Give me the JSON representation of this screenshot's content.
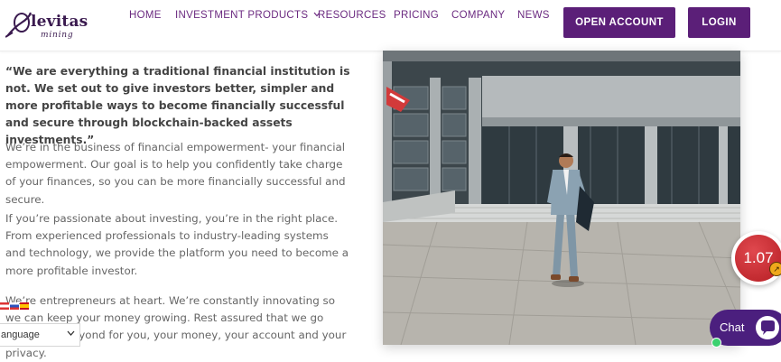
{
  "brand": {
    "name_line1": "levitas",
    "name_line2": "mining"
  },
  "nav": {
    "items": [
      "HOME",
      "INVESTMENT PRODUCTS",
      "RESOURCES",
      "PRICING",
      "COMPANY",
      "NEWS"
    ]
  },
  "buttons": {
    "open_account": "OPEN ACCOUNT",
    "login": "LOGIN"
  },
  "content": {
    "quote": "“We are everything a traditional financial institution is not. We set out to give investors better, simpler and more profitable ways to become financially successful and secure through blockchain-backed assets investments.”",
    "paragraph_1": "We’re in the business of financial empowerment- your financial empowerment. Our goal is to help you confidently take charge of your finances, so you can be more financially successful and secure.",
    "paragraph_2": "If you’re passionate about investing, you’re in the right place. From experienced professionals to industry-leading systems and technology, we provide the platform you need to become a more profitable investor.",
    "paragraph_3": "We’re entrepreneurs at heart. We’re constantly innovating so we can keep your money growing. Rest assured that we go above and beyond for you, your money, your account and your privacy."
  },
  "language_selector": {
    "label": "anguage"
  },
  "price_widget": {
    "value": "1.07"
  },
  "chat": {
    "label": "Chat"
  },
  "colors": {
    "brand_purple": "#5b1f78",
    "nav_purple": "#6b2a80",
    "price_red": "#c1272d"
  }
}
